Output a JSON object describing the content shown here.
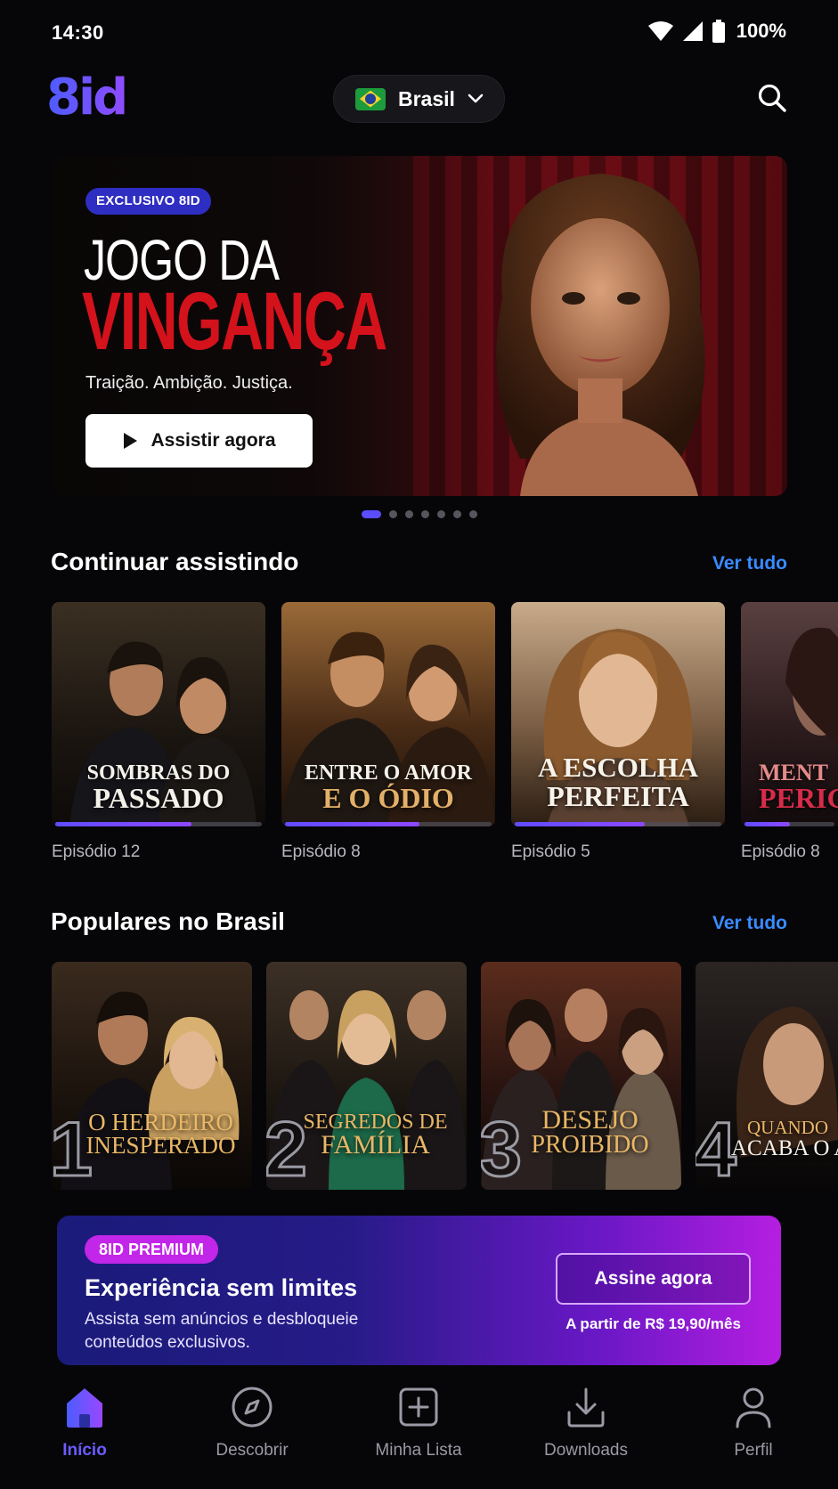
{
  "status_bar": {
    "time": "14:30",
    "battery": "100%"
  },
  "header": {
    "logo": "8id",
    "country": "Brasil"
  },
  "hero": {
    "badge": "EXCLUSIVO 8ID",
    "title_line1": "JOGO DA",
    "title_line2": "VINGANÇA",
    "tagline": "Traição. Ambição. Justiça.",
    "watch_label": "Assistir agora",
    "slides_total": 7,
    "active_slide": 1
  },
  "continue_watching": {
    "title": "Continuar assistindo",
    "see_all": "Ver tudo",
    "items": [
      {
        "line1": "SOMBRAS DO",
        "line2": "PASSADO",
        "episode": "Episódio 12",
        "progress": 0.66
      },
      {
        "line1": "ENTRE O AMOR",
        "line2": "E O ÓDIO",
        "episode": "Episódio 8",
        "progress": 0.65
      },
      {
        "line1": "A ESCOLHA",
        "line2": "PERFEITA",
        "episode": "Episódio 5",
        "progress": 0.63
      },
      {
        "line1": "MENT",
        "line2": "PERIG",
        "episode": "Episódio 8",
        "progress": 0.5
      }
    ]
  },
  "popular": {
    "title": "Populares no Brasil",
    "see_all": "Ver tudo",
    "items": [
      {
        "rank": "1",
        "line1": "O HERDEIRO",
        "line2": "INESPERADO"
      },
      {
        "rank": "2",
        "line1": "SEGREDOS DE",
        "line2": "FAMÍLIA"
      },
      {
        "rank": "3",
        "line1": "DESEJO",
        "line2": "PROIBIDO"
      },
      {
        "rank": "4",
        "line1": "QUANDO",
        "line2": "ACABA O A"
      }
    ]
  },
  "premium": {
    "badge": "8ID PREMIUM",
    "title": "Experiência sem limites",
    "description": "Assista sem anúncios e desbloqueie conteúdos exclusivos.",
    "button": "Assine agora",
    "price": "A partir de R$ 19,90/mês"
  },
  "nav": {
    "items": [
      {
        "label": "Início",
        "icon": "home-icon"
      },
      {
        "label": "Descobrir",
        "icon": "compass-icon"
      },
      {
        "label": "Minha Lista",
        "icon": "add-list-icon"
      },
      {
        "label": "Downloads",
        "icon": "download-icon"
      },
      {
        "label": "Perfil",
        "icon": "profile-icon"
      }
    ]
  },
  "colors": {
    "accent": "#5a4cff",
    "link": "#3a8bff",
    "hero_red": "#d4121b",
    "premium_badge": "#c226e8"
  }
}
